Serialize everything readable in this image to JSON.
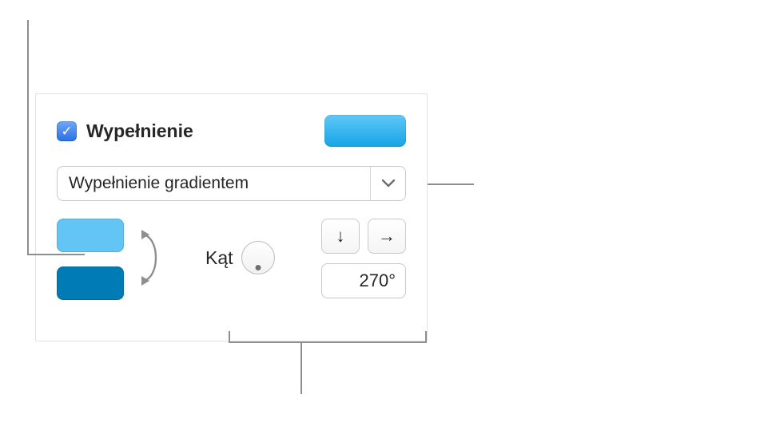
{
  "fill": {
    "checkbox_checked": true,
    "label": "Wypełnienie",
    "preview_gradient": {
      "from": "#60c7f7",
      "to": "#15a4e6"
    }
  },
  "fill_type": {
    "selected_label": "Wypełnienie gradientem"
  },
  "gradient": {
    "color1": "#62c5f4",
    "color2": "#007bb5",
    "angle_label": "Kąt",
    "angle_value": "270°",
    "dir_down": "↓",
    "dir_right": "→"
  },
  "icons": {
    "checkmark": "✓",
    "chevron_down": "⌄"
  }
}
